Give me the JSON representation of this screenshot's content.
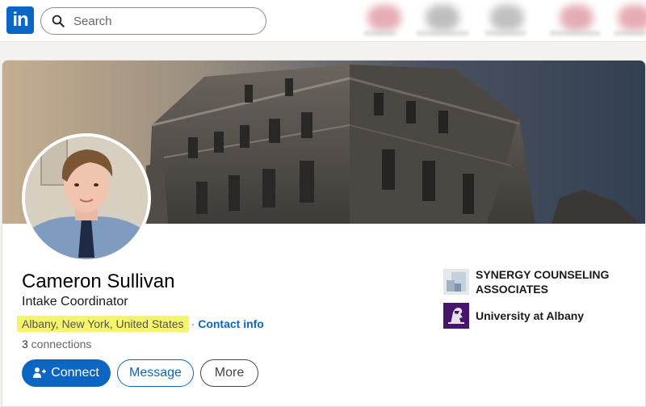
{
  "app": {
    "logo_text": "in",
    "brand_color": "#0a66c2"
  },
  "search": {
    "placeholder": "Search"
  },
  "profile": {
    "name": "Cameron Sullivan",
    "headline": "Intake Coordinator",
    "location": "Albany, New York, United States",
    "separator": "·",
    "contact_info": "Contact info",
    "connections_count": "3",
    "connections_label": " connections"
  },
  "actions": {
    "connect": "Connect",
    "message": "Message",
    "more": "More"
  },
  "organizations": [
    {
      "name": "SYNERGY COUNSELING ASSOCIATES",
      "icon": "company-logo-icon"
    },
    {
      "name": "University at Albany",
      "icon": "university-logo-icon"
    }
  ],
  "colors": {
    "highlight": "#f5f569",
    "accent": "#0a66c2"
  }
}
